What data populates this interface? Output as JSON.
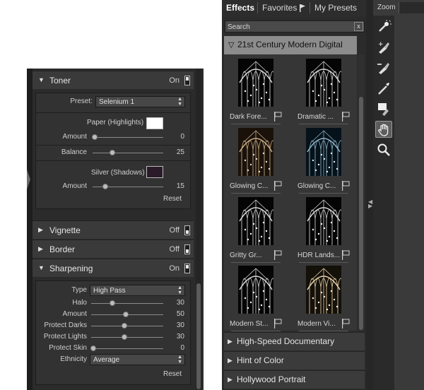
{
  "toner": {
    "title": "Toner",
    "state": "On",
    "preset_label": "Preset:",
    "preset_value": "Selenium 1",
    "paper_label": "Paper (Highlights)",
    "paper_color": "#ffffff",
    "paper_amount_label": "Amount",
    "paper_amount_value": "0",
    "balance_label": "Balance",
    "balance_value": "25",
    "silver_label": "Silver (Shadows)",
    "silver_color": "#2a1a2a",
    "silver_amount_label": "Amount",
    "silver_amount_value": "15",
    "reset_label": "Reset"
  },
  "vignette": {
    "title": "Vignette",
    "state": "Off"
  },
  "border": {
    "title": "Border",
    "state": "Off"
  },
  "sharpening": {
    "title": "Sharpening",
    "state": "On",
    "type_label": "Type",
    "type_value": "High Pass",
    "halo_label": "Halo",
    "halo_value": "30",
    "amount_label": "Amount",
    "amount_value": "50",
    "protect_darks_label": "Protect Darks",
    "protect_darks_value": "30",
    "protect_lights_label": "Protect Lights",
    "protect_lights_value": "30",
    "protect_skin_label": "Protect Skin",
    "protect_skin_value": "0",
    "ethnicity_label": "Ethnicity",
    "ethnicity_value": "Average",
    "reset_label": "Reset"
  },
  "browser": {
    "tabs": [
      "Effects",
      "Favorites",
      "My Presets"
    ],
    "search_placeholder": "Search",
    "search_clear": "x",
    "open_category": "21st Century Modern Digital",
    "thumbnails": [
      {
        "label": "Dark Fore...",
        "tone": "bw"
      },
      {
        "label": "Dramatic ...",
        "tone": "bw"
      },
      {
        "label": "Glowing C...",
        "tone": "sepia"
      },
      {
        "label": "Glowing C...",
        "tone": "blue"
      },
      {
        "label": "Gritty Gr...",
        "tone": "bw"
      },
      {
        "label": "HDR Lands...",
        "tone": "bw"
      },
      {
        "label": "Modern St...",
        "tone": "bw"
      },
      {
        "label": "Modern Vi...",
        "tone": "warm"
      }
    ],
    "categories": [
      "High-Speed Documentary",
      "Hint of Color",
      "Hollywood Portrait"
    ]
  },
  "tools": {
    "zoom_label": "Zoom",
    "icons": [
      "magic-brush-icon",
      "brush-add-icon",
      "brush-remove-icon",
      "pen-icon",
      "mask-brush-icon",
      "hand-icon",
      "magnifier-icon"
    ]
  }
}
